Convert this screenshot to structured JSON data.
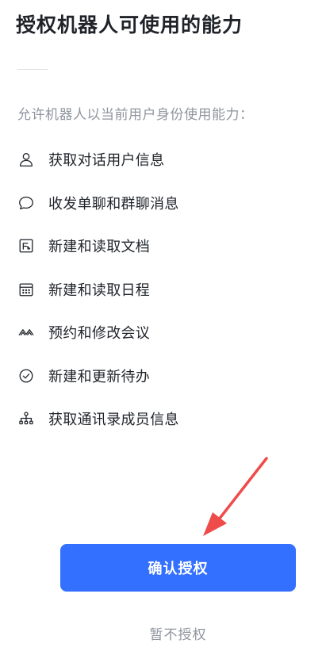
{
  "page": {
    "title": "授权机器人可使用的能力",
    "intro": "允许机器人以当前用户身份使用能力："
  },
  "permissions": [
    {
      "label": "获取对话用户信息",
      "icon": "user-icon"
    },
    {
      "label": "收发单聊和群聊消息",
      "icon": "chat-bubble-icon"
    },
    {
      "label": "新建和读取文档",
      "icon": "document-icon"
    },
    {
      "label": "新建和读取日程",
      "icon": "calendar-icon"
    },
    {
      "label": "预约和修改会议",
      "icon": "meeting-icon"
    },
    {
      "label": "新建和更新待办",
      "icon": "check-circle-icon"
    },
    {
      "label": "获取通讯录成员信息",
      "icon": "org-chart-icon"
    }
  ],
  "actions": {
    "confirm_label": "确认授权",
    "decline_label": "暂不授权"
  },
  "colors": {
    "primary": "#3370ff",
    "text": "#1f2329",
    "muted": "#8f959e",
    "annotation_arrow": "#ef4b4b"
  }
}
